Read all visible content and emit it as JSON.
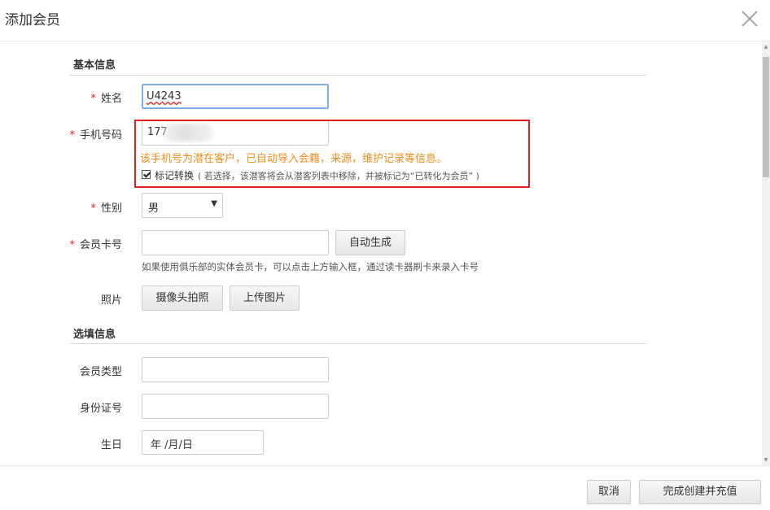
{
  "dialog": {
    "title": "添加会员"
  },
  "basic": {
    "section_title": "基本信息",
    "name": {
      "label": "姓名",
      "value": "U4243"
    },
    "phone": {
      "label": "手机号码",
      "value": "177"
    },
    "warning": "该手机号为潜在客户，已自动导入会籍，来源，维护记录等信息。",
    "mark_convert": {
      "label": "标记转换",
      "note": "( 若选择，该潜客将会从潜客列表中移除，并被标记为“已转化为会员” )",
      "checked": true
    },
    "gender": {
      "label": "性别",
      "value": "男"
    },
    "card_no": {
      "label": "会员卡号",
      "auto_button": "自动生成",
      "hint": "如果使用俱乐部的实体会员卡，可以点击上方输入框，通过读卡器刷卡来录入卡号"
    },
    "photo": {
      "label": "照片",
      "camera_button": "摄像头拍照",
      "upload_button": "上传图片"
    }
  },
  "optional": {
    "section_title": "选填信息",
    "member_type": {
      "label": "会员类型"
    },
    "id_number": {
      "label": "身份证号"
    },
    "birthday": {
      "label": "生日",
      "placeholder": "年 /月/日"
    }
  },
  "required_mark": "*",
  "footer": {
    "cancel": "取消",
    "confirm": "完成创建并充值"
  },
  "colors": {
    "required": "#e02020",
    "warning": "#f08c1b",
    "focus": "#80aee8",
    "highlight": "#e02020"
  }
}
